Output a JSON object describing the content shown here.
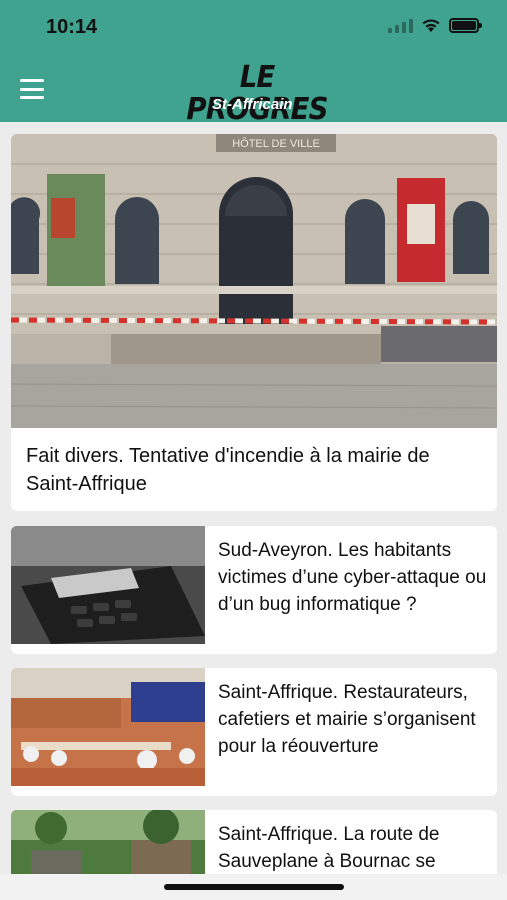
{
  "status_bar": {
    "time": "10:14"
  },
  "header": {
    "logo_main": "LE PROGRES",
    "logo_sub": "St-Affricain",
    "background_color": "#3fa38f",
    "menu_icon": "hamburger-menu-icon"
  },
  "articles": [
    {
      "title": "Fait divers. Tentative d'incendie à la mairie de Saint-Affrique",
      "image_sign": "HÔTEL DE VILLE"
    },
    {
      "title": "Sud-Aveyron. Les habitants victimes d’une cyber-attaque ou d’un bug informatique ?"
    },
    {
      "title": "Saint-Affrique. Restaurateurs, cafetiers et mairie s’organisent pour la réouverture"
    },
    {
      "title": "Saint-Affrique. La route de Sauveplane à Bournac se"
    }
  ]
}
